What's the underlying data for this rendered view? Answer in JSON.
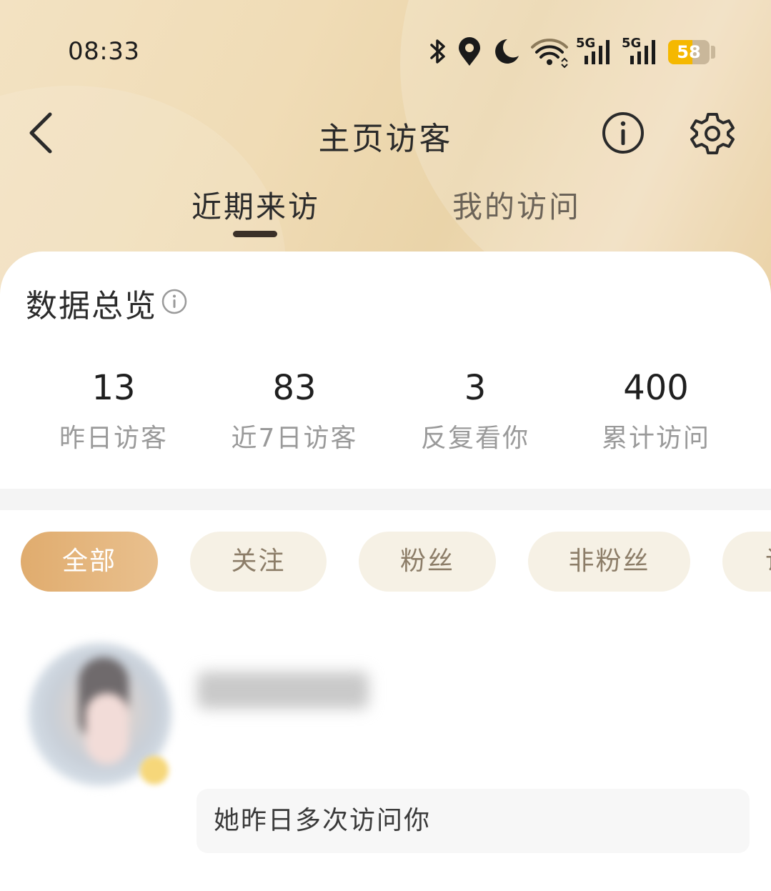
{
  "status_bar": {
    "time": "08:33",
    "battery": "58",
    "battery_level": 0.58,
    "signal_1_label": "5G",
    "signal_2_label": "5G",
    "icons": [
      "bluetooth-icon",
      "location-icon",
      "moon-icon",
      "wifi-icon",
      "signal-icon",
      "signal-icon",
      "battery-icon"
    ]
  },
  "nav": {
    "title": "主页访客",
    "back_icon": "chevron-left-icon",
    "info_icon": "info-icon",
    "settings_icon": "gear-icon"
  },
  "tabs": [
    {
      "label": "近期来访",
      "active": true
    },
    {
      "label": "我的访问",
      "active": false
    }
  ],
  "overview": {
    "title": "数据总览",
    "stats": [
      {
        "value": "13",
        "label": "昨日访客"
      },
      {
        "value": "83",
        "label": "近7日访客"
      },
      {
        "value": "3",
        "label": "反复看你"
      },
      {
        "value": "400",
        "label": "累计访问"
      }
    ]
  },
  "filters": [
    {
      "label": "全部",
      "active": true
    },
    {
      "label": "关注",
      "active": false
    },
    {
      "label": "粉丝",
      "active": false
    },
    {
      "label": "非粉丝",
      "active": false
    },
    {
      "label": "访",
      "active": false
    }
  ],
  "visitor": {
    "note": "她昨日多次访问你"
  },
  "colors": {
    "accent": "#e0ac6e",
    "chip_bg": "#f6f1e5",
    "header_bg": "#f0dcb6",
    "battery": "#f5b800"
  }
}
